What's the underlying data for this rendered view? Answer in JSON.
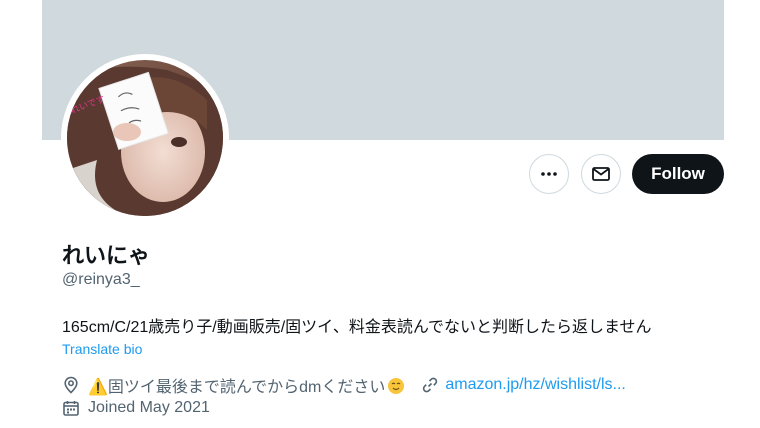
{
  "profile": {
    "display_name": "れいにゃ",
    "handle": "@reinya3_",
    "bio": "165cm/C/21歳売り子/動画販売/固ツイ、料金表読んでないと判断したら返しません",
    "translate_label": "Translate bio",
    "location": "固ツイ最後まで読んでからdmください",
    "location_prefix_glyph": "⚠️",
    "website": "amazon.jp/hz/wishlist/ls...",
    "joined": "Joined May 2021"
  },
  "actions": {
    "more_icon": "more-horizontal-icon",
    "message_icon": "mail-icon",
    "follow_label": "Follow"
  },
  "colors": {
    "banner": "#cfd9de",
    "accent": "#1d9bf0",
    "primary_text": "#0f1419",
    "secondary_text": "#536471",
    "follow_bg": "#0f1419"
  },
  "icons": {
    "location": "location-pin-icon",
    "link": "link-icon",
    "calendar": "calendar-icon",
    "warning": "warning-icon",
    "emoji": "smiling-face-emoji"
  }
}
